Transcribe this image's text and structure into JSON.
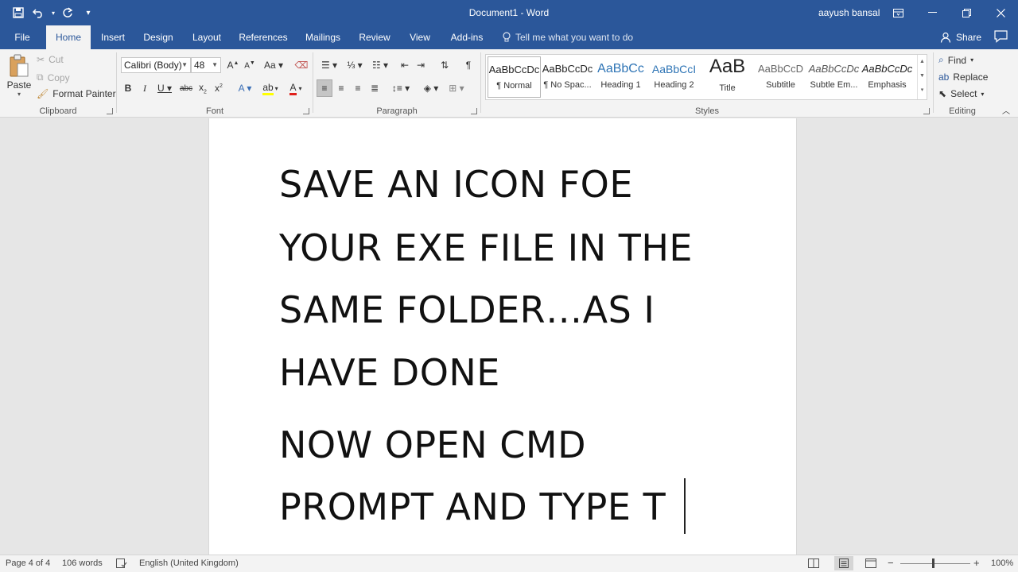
{
  "titlebar": {
    "document_title": "Document1 - Word",
    "user": "aayush bansal",
    "accent": "#2b579a"
  },
  "tabs": [
    "File",
    "Home",
    "Insert",
    "Design",
    "Layout",
    "References",
    "Mailings",
    "Review",
    "View",
    "Add-ins"
  ],
  "tellme": "Tell me what you want to do",
  "share": "Share",
  "clipboard": {
    "paste": "Paste",
    "cut": "Cut",
    "copy": "Copy",
    "format_painter": "Format Painter",
    "label": "Clipboard"
  },
  "font": {
    "name": "Calibri (Body)",
    "size": "48",
    "label": "Font"
  },
  "paragraph": {
    "label": "Paragraph"
  },
  "styles": {
    "label": "Styles",
    "items": [
      {
        "preview": "AaBbCcDc",
        "name": "¶ Normal"
      },
      {
        "preview": "AaBbCcDc",
        "name": "¶ No Spac..."
      },
      {
        "preview": "AaBbCc",
        "name": "Heading 1"
      },
      {
        "preview": "AaBbCcI",
        "name": "Heading 2"
      },
      {
        "preview": "AaB",
        "name": "Title"
      },
      {
        "preview": "AaBbCcD",
        "name": "Subtitle"
      },
      {
        "preview": "AaBbCcDc",
        "name": "Subtle Em..."
      },
      {
        "preview": "AaBbCcDc",
        "name": "Emphasis"
      }
    ]
  },
  "editing": {
    "find": "Find",
    "replace": "Replace",
    "select": "Select",
    "label": "Editing"
  },
  "document": {
    "lines": [
      "SAVE AN ICON FOE",
      "YOUR EXE FILE IN THE",
      "SAME FOLDER…AS I",
      "HAVE DONE",
      "NOW OPEN CMD",
      "PROMPT AND TYPE T"
    ]
  },
  "status": {
    "page": "Page 4 of 4",
    "words": "106 words",
    "language": "English (United Kingdom)",
    "zoom": "100%"
  }
}
